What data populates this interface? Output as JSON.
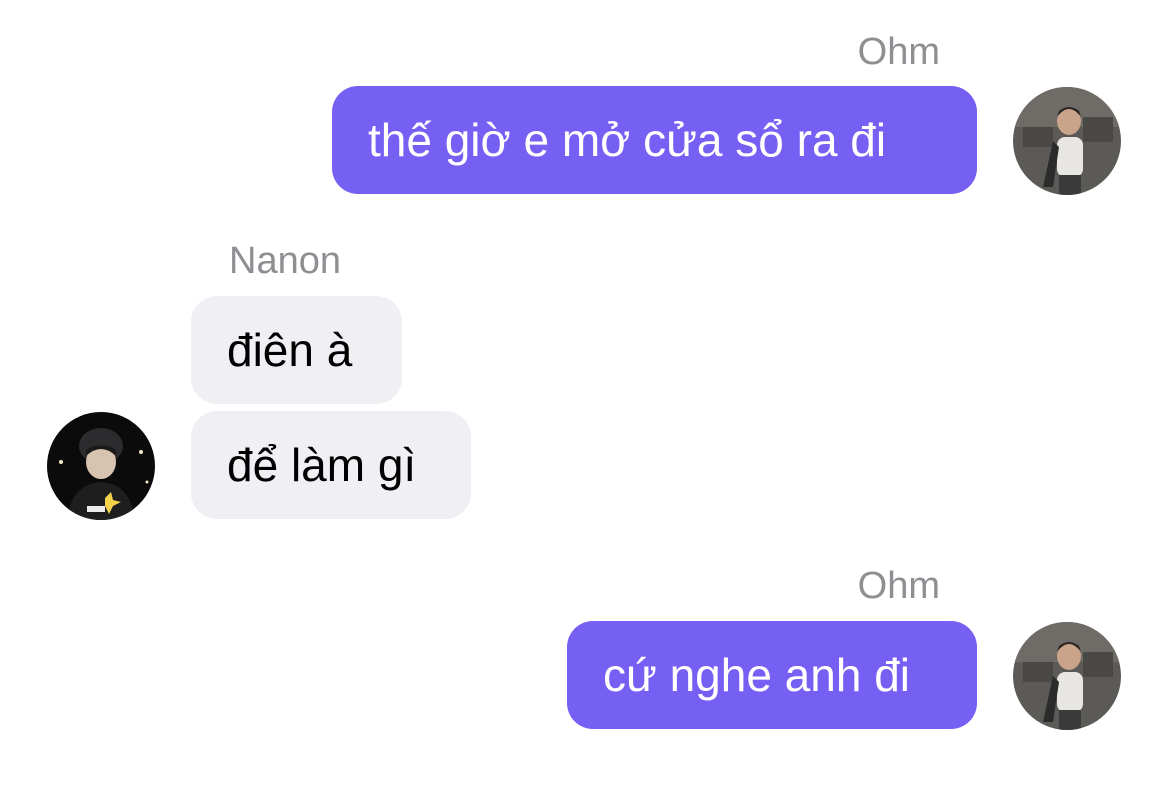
{
  "messages": [
    {
      "sender": "Ohm",
      "text": "thế giờ e mở cửa sổ ra đi",
      "direction": "outgoing"
    },
    {
      "sender": "Nanon",
      "text": "điên à",
      "direction": "incoming"
    },
    {
      "sender": "Nanon",
      "text": "để làm gì",
      "direction": "incoming"
    },
    {
      "sender": "Ohm",
      "text": "cứ nghe anh đi",
      "direction": "outgoing"
    }
  ],
  "colors": {
    "outgoing_bubble": "#7660f4",
    "incoming_bubble": "#efeff4",
    "sender_name": "#8e8e93"
  },
  "avatars": {
    "ohm": "ohm-avatar-photo",
    "nanon": "nanon-avatar-photo"
  }
}
